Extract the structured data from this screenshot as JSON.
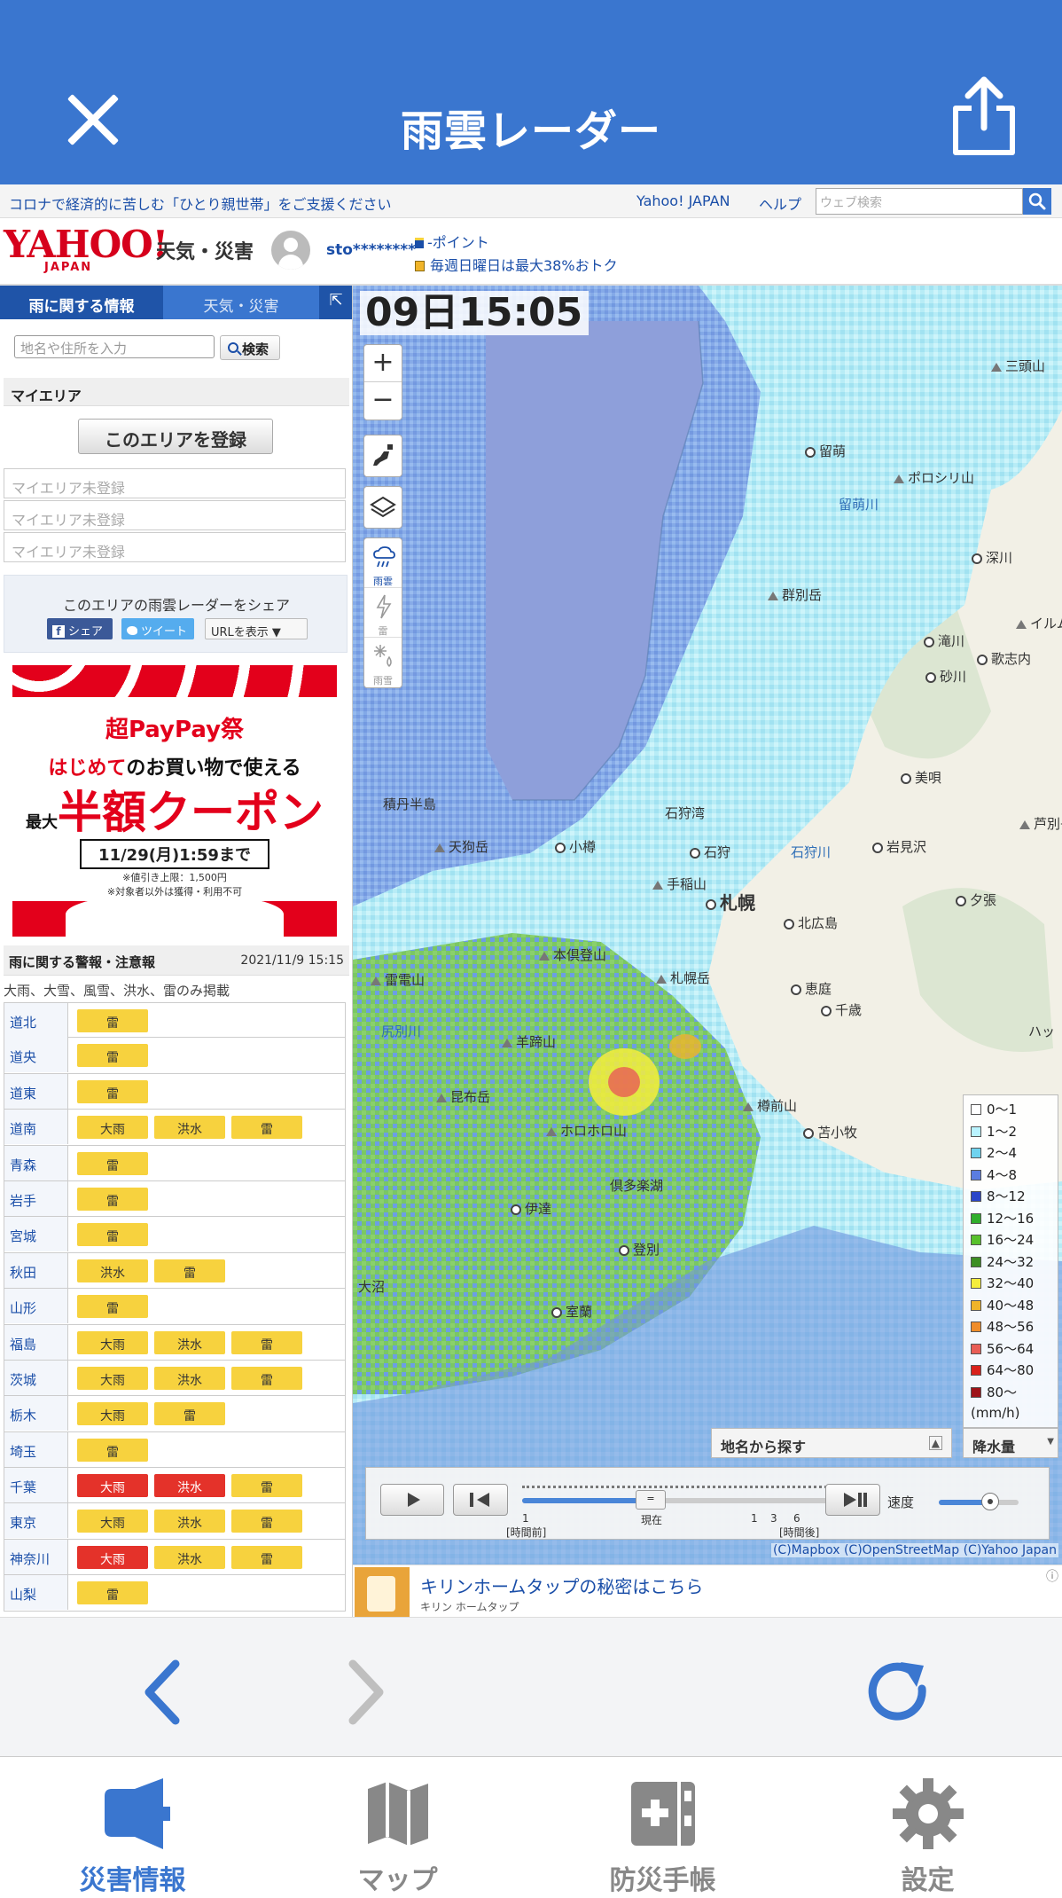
{
  "app": {
    "title": "雨雲レーダー",
    "close_icon": "close-icon",
    "share_icon": "share-icon"
  },
  "topbar": {
    "notice": "コロナで経済的に苦しむ「ひとり親世帯」をご支援ください",
    "yahoo_link": "Yahoo! JAPAN",
    "help_link": "ヘルプ",
    "search_placeholder": "ウェブ検索"
  },
  "header": {
    "logo": "YAHOO!",
    "logo_sub": "JAPAN",
    "site_name": "天気・災害",
    "username": "sto********",
    "points": "-ポイント",
    "promo": "毎週日曜日は最大38%おトク"
  },
  "sidebar": {
    "tabs": [
      "雨に関する情報",
      "天気・災害",
      "⇱"
    ],
    "place_placeholder": "地名や住所を入力",
    "search_button": "検索",
    "myarea_heading": "マイエリア",
    "register_button": "このエリアを登録",
    "myarea_slots": [
      "マイエリア未登録",
      "マイエリア未登録",
      "マイエリア未登録"
    ],
    "share_title": "このエリアの雨雲レーダーをシェア",
    "share_facebook": "シェア",
    "share_twitter": "ツイート",
    "share_url": "URLを表示 ▼"
  },
  "ad": {
    "brand": "超PayPay祭",
    "line1_highlight": "はじめて",
    "line1_rest": "のお買い物で使える",
    "line2_prefix": "最大",
    "line2": "半額クーポン",
    "deadline": "11/29(月)1:59まで",
    "note1": "※値引き上限：1,500円",
    "note2": "※対象者以外は獲得・利用不可"
  },
  "warnings": {
    "heading": "雨に関する警報・注意報",
    "datetime": "2021/11/9 15:15",
    "note": "大雨、大雪、風雪、洪水、雷のみ掲載",
    "rows": [
      {
        "pref": "道北",
        "badges": [
          {
            "label": "雷",
            "level": "advisory"
          }
        ]
      },
      {
        "pref": "道央",
        "badges": [
          {
            "label": "雷",
            "level": "advisory"
          }
        ]
      },
      {
        "pref": "道東",
        "badges": [
          {
            "label": "雷",
            "level": "advisory"
          }
        ]
      },
      {
        "pref": "道南",
        "badges": [
          {
            "label": "大雨",
            "level": "advisory"
          },
          {
            "label": "洪水",
            "level": "advisory"
          },
          {
            "label": "雷",
            "level": "advisory"
          }
        ]
      },
      {
        "pref": "青森",
        "badges": [
          {
            "label": "雷",
            "level": "advisory"
          }
        ]
      },
      {
        "pref": "岩手",
        "badges": [
          {
            "label": "雷",
            "level": "advisory"
          }
        ]
      },
      {
        "pref": "宮城",
        "badges": [
          {
            "label": "雷",
            "level": "advisory"
          }
        ]
      },
      {
        "pref": "秋田",
        "badges": [
          {
            "label": "洪水",
            "level": "advisory"
          },
          {
            "label": "雷",
            "level": "advisory"
          }
        ]
      },
      {
        "pref": "山形",
        "badges": [
          {
            "label": "雷",
            "level": "advisory"
          }
        ]
      },
      {
        "pref": "福島",
        "badges": [
          {
            "label": "大雨",
            "level": "advisory"
          },
          {
            "label": "洪水",
            "level": "advisory"
          },
          {
            "label": "雷",
            "level": "advisory"
          }
        ]
      },
      {
        "pref": "茨城",
        "badges": [
          {
            "label": "大雨",
            "level": "advisory"
          },
          {
            "label": "洪水",
            "level": "advisory"
          },
          {
            "label": "雷",
            "level": "advisory"
          }
        ]
      },
      {
        "pref": "栃木",
        "badges": [
          {
            "label": "大雨",
            "level": "advisory"
          },
          {
            "label": "雷",
            "level": "advisory"
          }
        ]
      },
      {
        "pref": "埼玉",
        "badges": [
          {
            "label": "雷",
            "level": "advisory"
          }
        ]
      },
      {
        "pref": "千葉",
        "badges": [
          {
            "label": "大雨",
            "level": "warning"
          },
          {
            "label": "洪水",
            "level": "warning"
          },
          {
            "label": "雷",
            "level": "advisory"
          }
        ]
      },
      {
        "pref": "東京",
        "badges": [
          {
            "label": "大雨",
            "level": "advisory"
          },
          {
            "label": "洪水",
            "level": "advisory"
          },
          {
            "label": "雷",
            "level": "advisory"
          }
        ]
      },
      {
        "pref": "神奈川",
        "badges": [
          {
            "label": "大雨",
            "level": "warning"
          },
          {
            "label": "洪水",
            "level": "advisory"
          },
          {
            "label": "雷",
            "level": "advisory"
          }
        ]
      },
      {
        "pref": "山梨",
        "badges": [
          {
            "label": "雷",
            "level": "advisory"
          }
        ]
      }
    ],
    "colors": {
      "advisory": "#f7d23e",
      "warning": "#e4322a"
    }
  },
  "map": {
    "timestamp": "09日15:05",
    "zoom_in": "+",
    "zoom_out": "−",
    "layers": [
      "雨雲",
      "雷",
      "雨雪"
    ],
    "places": [
      {
        "name": "三頭山",
        "kind": "peak"
      },
      {
        "name": "留萌",
        "kind": "city"
      },
      {
        "name": "ポロシリ山",
        "kind": "peak"
      },
      {
        "name": "留萌川",
        "kind": "river"
      },
      {
        "name": "深川",
        "kind": "city"
      },
      {
        "name": "群別岳",
        "kind": "peak"
      },
      {
        "name": "イルム",
        "kind": "peak"
      },
      {
        "name": "滝川",
        "kind": "city"
      },
      {
        "name": "歌志内",
        "kind": "city"
      },
      {
        "name": "砂川",
        "kind": "city"
      },
      {
        "name": "美唄",
        "kind": "city"
      },
      {
        "name": "積丹半島",
        "kind": "label"
      },
      {
        "name": "石狩湾",
        "kind": "label"
      },
      {
        "name": "芦別岳",
        "kind": "peak"
      },
      {
        "name": "天狗岳",
        "kind": "peak"
      },
      {
        "name": "小樽",
        "kind": "city"
      },
      {
        "name": "石狩",
        "kind": "city"
      },
      {
        "name": "石狩川",
        "kind": "river"
      },
      {
        "name": "岩見沢",
        "kind": "city"
      },
      {
        "name": "手稲山",
        "kind": "peak"
      },
      {
        "name": "札幌",
        "kind": "major"
      },
      {
        "name": "夕張",
        "kind": "city"
      },
      {
        "name": "北広島",
        "kind": "city"
      },
      {
        "name": "本倶登山",
        "kind": "peak"
      },
      {
        "name": "雷電山",
        "kind": "peak"
      },
      {
        "name": "札幌岳",
        "kind": "peak"
      },
      {
        "name": "恵庭",
        "kind": "city"
      },
      {
        "name": "千歳",
        "kind": "city"
      },
      {
        "name": "尻別川",
        "kind": "river"
      },
      {
        "name": "羊蹄山",
        "kind": "peak"
      },
      {
        "name": "ハッ",
        "kind": "label"
      },
      {
        "name": "昆布岳",
        "kind": "peak"
      },
      {
        "name": "樽前山",
        "kind": "peak"
      },
      {
        "name": "ホロホロ山",
        "kind": "peak"
      },
      {
        "name": "苫小牧",
        "kind": "city"
      },
      {
        "name": "倶多楽湖",
        "kind": "label"
      },
      {
        "name": "伊達",
        "kind": "city"
      },
      {
        "name": "登別",
        "kind": "city"
      },
      {
        "name": "室蘭",
        "kind": "city"
      },
      {
        "name": "大沼",
        "kind": "label"
      }
    ],
    "legend": {
      "items": [
        {
          "label": "0〜1",
          "color": "#ffffff"
        },
        {
          "label": "1〜2",
          "color": "#b9f3ff"
        },
        {
          "label": "2〜4",
          "color": "#6fd3ef"
        },
        {
          "label": "4〜8",
          "color": "#5b7de0"
        },
        {
          "label": "8〜12",
          "color": "#2b46c9"
        },
        {
          "label": "12〜16",
          "color": "#2fae2b"
        },
        {
          "label": "16〜24",
          "color": "#57c12c"
        },
        {
          "label": "24〜32",
          "color": "#3c8e23"
        },
        {
          "label": "32〜40",
          "color": "#f5ed3c"
        },
        {
          "label": "40〜48",
          "color": "#f0b429"
        },
        {
          "label": "48〜56",
          "color": "#ef8d2a"
        },
        {
          "label": "56〜64",
          "color": "#e95d55"
        },
        {
          "label": "64〜80",
          "color": "#d9211b"
        },
        {
          "label": "80〜",
          "color": "#9e1318"
        }
      ],
      "unit": "(mm/h)"
    },
    "find_place": "地名から探す",
    "precip_select": "降水量",
    "player": {
      "ticks": [
        "1",
        "現在",
        "1",
        "3",
        "6"
      ],
      "past_label": "[時間前]",
      "future_label": "[時間後]",
      "speed_label": "速度",
      "knob_label": "="
    },
    "credit": "(C)Mapbox (C)OpenStreetMap (C)Yahoo Japan"
  },
  "bottom_ad": {
    "title": "キリンホームタップの秘密はこちら",
    "sponsor": "キリン ホームタップ",
    "info": "ⓘ"
  },
  "browser_nav": {
    "back_icon": "chevron-left-icon",
    "forward_icon": "chevron-right-icon",
    "reload_icon": "reload-icon"
  },
  "tabbar": {
    "tabs": [
      {
        "label": "災害情報",
        "icon": "megaphone-icon",
        "active": true
      },
      {
        "label": "マップ",
        "icon": "map-icon",
        "active": false
      },
      {
        "label": "防災手帳",
        "icon": "first-aid-notebook-icon",
        "active": false
      },
      {
        "label": "設定",
        "icon": "gear-icon",
        "active": false
      }
    ]
  }
}
